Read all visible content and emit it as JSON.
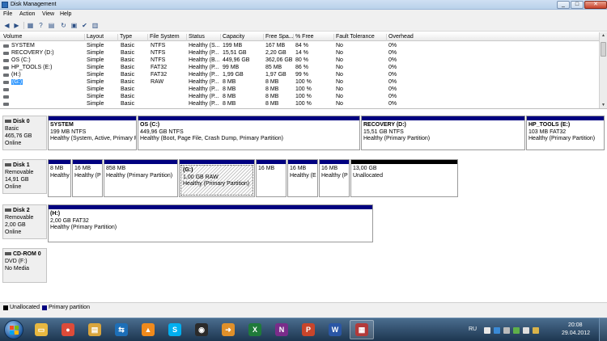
{
  "window": {
    "title": "Disk Management",
    "min": "_",
    "max": "□",
    "close": "✕"
  },
  "menu": [
    "File",
    "Action",
    "View",
    "Help"
  ],
  "toolbar": {
    "icons": [
      "back-icon",
      "forward-icon",
      "show-hide-console-tree-icon",
      "help-icon",
      "properties-icon",
      "refresh-icon",
      "connect-icon",
      "checkmark-icon",
      "settings-icon"
    ]
  },
  "volume_table": {
    "columns": [
      "Volume",
      "Layout",
      "Type",
      "File System",
      "Status",
      "Capacity",
      "Free Spa...",
      "% Free",
      "Fault Tolerance",
      "Overhead"
    ],
    "rows": [
      [
        "SYSTEM",
        "Simple",
        "Basic",
        "NTFS",
        "Healthy (S...",
        "199 MB",
        "167 MB",
        "84 %",
        "No",
        "0%"
      ],
      [
        "RECOVERY (D:)",
        "Simple",
        "Basic",
        "NTFS",
        "Healthy (P...",
        "15,51 GB",
        "2,20 GB",
        "14 %",
        "No",
        "0%"
      ],
      [
        "OS (C:)",
        "Simple",
        "Basic",
        "NTFS",
        "Healthy (B...",
        "449,96 GB",
        "362,06 GB",
        "80 %",
        "No",
        "0%"
      ],
      [
        "HP_TOOLS (E:)",
        "Simple",
        "Basic",
        "FAT32",
        "Healthy (P...",
        "99 MB",
        "85 MB",
        "86 %",
        "No",
        "0%"
      ],
      [
        "(H:)",
        "Simple",
        "Basic",
        "FAT32",
        "Healthy (P...",
        "1,99 GB",
        "1,97 GB",
        "99 %",
        "No",
        "0%"
      ],
      [
        "(G:)",
        "Simple",
        "Basic",
        "RAW",
        "Healthy (P...",
        "8 MB",
        "8 MB",
        "100 %",
        "No",
        "0%"
      ],
      [
        "",
        "Simple",
        "Basic",
        "",
        "Healthy (P...",
        "8 MB",
        "8 MB",
        "100 %",
        "No",
        "0%"
      ],
      [
        "",
        "Simple",
        "Basic",
        "",
        "Healthy (P...",
        "8 MB",
        "8 MB",
        "100 %",
        "No",
        "0%"
      ],
      [
        "",
        "Simple",
        "Basic",
        "",
        "Healthy (P...",
        "8 MB",
        "8 MB",
        "100 %",
        "No",
        "0%"
      ],
      [
        "",
        "Simple",
        "Basic",
        "",
        "Healthy (P...",
        "8 MB",
        "8 MB",
        "100 %",
        "No",
        "0%"
      ]
    ],
    "selected_row": 5
  },
  "disks": [
    {
      "label": {
        "name": "Disk 0",
        "type": "Basic",
        "size": "465,76 GB",
        "state": "Online"
      },
      "partitions": [
        {
          "name": "SYSTEM",
          "size": "199 MB NTFS",
          "status": "Healthy (System, Active, Primary Pa"
        },
        {
          "name": "OS  (C:)",
          "size": "449,96 GB NTFS",
          "status": "Healthy (Boot, Page File, Crash Dump, Primary Partition)"
        },
        {
          "name": "RECOVERY  (D:)",
          "size": "15,51 GB NTFS",
          "status": "Healthy (Primary Partition)"
        },
        {
          "name": "HP_TOOLS  (E:)",
          "size": "103 MB FAT32",
          "status": "Healthy (Primary Partition)"
        }
      ]
    },
    {
      "label": {
        "name": "Disk 1",
        "type": "Removable",
        "size": "14,91 GB",
        "state": "Online"
      },
      "partitions": [
        {
          "name": "",
          "size": "8 MB",
          "status": "Healthy"
        },
        {
          "name": "",
          "size": "16 MB",
          "status": "Healthy (P"
        },
        {
          "name": "",
          "size": "858 MB",
          "status": "Healthy (Primary Partition)"
        },
        {
          "name": "(G:)",
          "size": "1,00 GB RAW",
          "status": "Healthy (Primary Partition)"
        },
        {
          "name": "",
          "size": "16 MB",
          "status": ""
        },
        {
          "name": "",
          "size": "16 MB",
          "status": "Healthy (E"
        },
        {
          "name": "",
          "size": "16 MB",
          "status": "Healthy (P"
        },
        {
          "name": "",
          "size": "13,00 GB",
          "status": "Unallocated"
        }
      ]
    },
    {
      "label": {
        "name": "Disk 2",
        "type": "Removable",
        "size": "2,00 GB",
        "state": "Online"
      },
      "partitions": [
        {
          "name": "(H:)",
          "size": "2,00 GB FAT32",
          "status": "Healthy (Primary Partition)"
        }
      ]
    },
    {
      "label": {
        "name": "CD-ROM 0",
        "type": "DVD (F:)",
        "size": "",
        "state": "No Media"
      },
      "partitions": []
    }
  ],
  "legend": [
    {
      "label": "Unallocated",
      "color": "#000000"
    },
    {
      "label": "Primary partition",
      "color": "#000080"
    }
  ],
  "taskbar": {
    "apps": [
      {
        "name": "windows-explorer",
        "glyph": "▭",
        "color": "#e8b840"
      },
      {
        "name": "chrome",
        "glyph": "●",
        "color": "#dd4b39"
      },
      {
        "name": "file-manager",
        "glyph": "▤",
        "color": "#d9a53c"
      },
      {
        "name": "teamviewer",
        "glyph": "⇆",
        "color": "#1d6fb8"
      },
      {
        "name": "vlc",
        "glyph": "▲",
        "color": "#f08a1c"
      },
      {
        "name": "skype",
        "glyph": "S",
        "color": "#00aff0"
      },
      {
        "name": "media-player",
        "glyph": "◉",
        "color": "#2b2b2b"
      },
      {
        "name": "transfer",
        "glyph": "➜",
        "color": "#e0902a"
      },
      {
        "name": "excel",
        "glyph": "X",
        "color": "#1f7a3a"
      },
      {
        "name": "onenote",
        "glyph": "N",
        "color": "#7a2c8a"
      },
      {
        "name": "powerpoint",
        "glyph": "P",
        "color": "#c8452b"
      },
      {
        "name": "word",
        "glyph": "W",
        "color": "#2a56a5"
      },
      {
        "name": "disk-management",
        "glyph": "▦",
        "color": "#b33a3a"
      }
    ],
    "tray": {
      "lang": "RU",
      "time": "20:08",
      "date": "29.04.2012"
    }
  }
}
